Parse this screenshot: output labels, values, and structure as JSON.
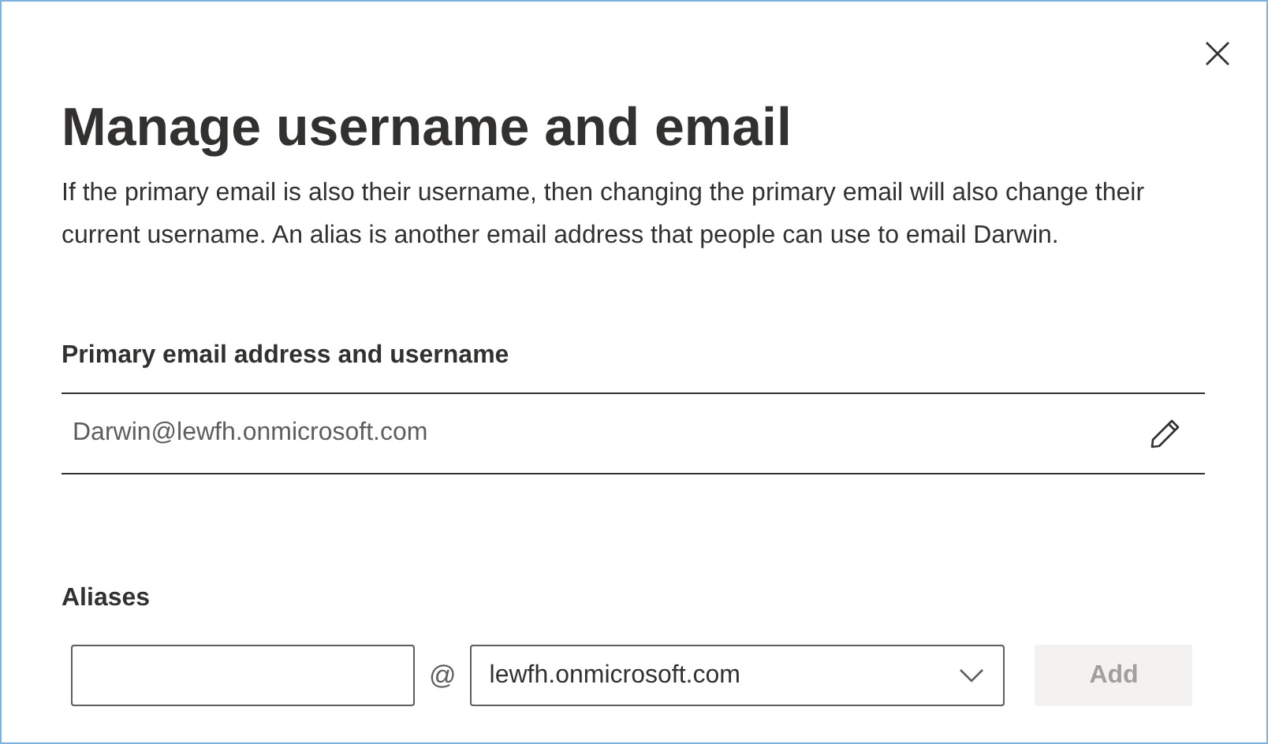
{
  "dialog": {
    "title": "Manage username and email",
    "description": "If the primary email is also their username, then changing the primary email will also change their current username. An alias is another email address that people can use to email Darwin."
  },
  "primary": {
    "label": "Primary email address and username",
    "value": "Darwin@lewfh.onmicrosoft.com"
  },
  "aliases": {
    "label": "Aliases",
    "at_sign": "@",
    "domain": "lewfh.onmicrosoft.com",
    "add_button": {
      "label": "Add",
      "disabled": true
    }
  }
}
